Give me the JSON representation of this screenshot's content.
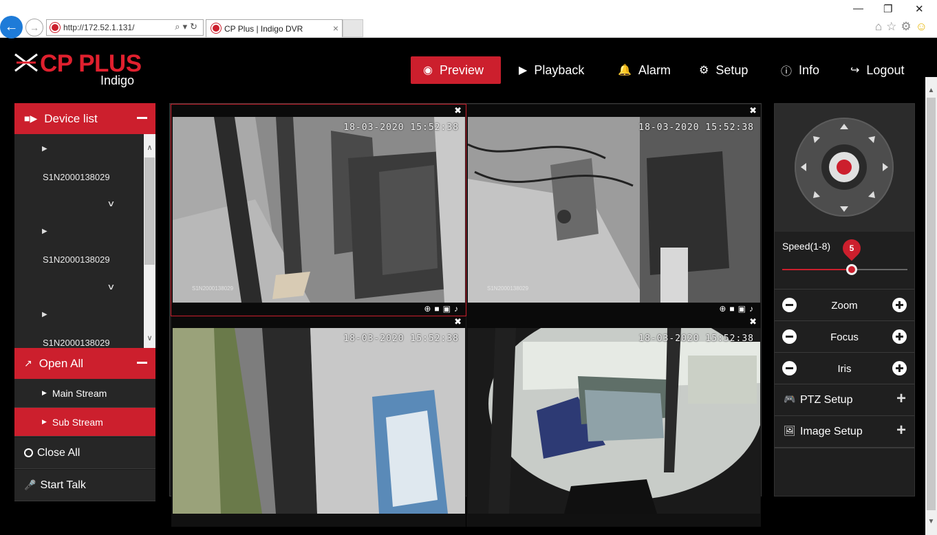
{
  "browser": {
    "url": "http://172.52.1.131/",
    "tab_title": "CP Plus | Indigo DVR",
    "tab_close": "×",
    "minimize": "—",
    "restore": "❐",
    "close": "✕"
  },
  "app": {
    "brand": "CP PLUS",
    "brand_sub": "Indigo",
    "nav": [
      {
        "label": "Preview",
        "icon": "eye-icon"
      },
      {
        "label": "Playback",
        "icon": "play-icon"
      },
      {
        "label": "Alarm",
        "icon": "bell-icon"
      },
      {
        "label": "Setup",
        "icon": "gear-icon"
      },
      {
        "label": "Info",
        "icon": "info-icon"
      },
      {
        "label": "Logout",
        "icon": "logout-icon"
      }
    ],
    "accent": "#cc1f2d"
  },
  "left_panel": {
    "device_list_title": "Device list",
    "devices": [
      {
        "name": "S1N2000138029"
      },
      {
        "name": "S1N2000138029"
      },
      {
        "name": "S1N2000138029"
      }
    ],
    "open_all_title": "Open All",
    "main_stream": "Main Stream",
    "sub_stream": "Sub Stream",
    "close_all": "Close All",
    "start_talk": "Start Talk"
  },
  "cameras": [
    {
      "timestamp": "18-03-2020 15:52:38",
      "watermark": "S1N2000138029",
      "selected": true
    },
    {
      "timestamp": "18-03-2020 15:52:38",
      "watermark": "S1N2000138029",
      "selected": false
    },
    {
      "timestamp": "18-03-2020 15:52:38",
      "watermark": "",
      "selected": false
    },
    {
      "timestamp": "18-03-2020 15:52:38",
      "watermark": "",
      "selected": false
    }
  ],
  "right_panel": {
    "speed_label": "Speed(1-8)",
    "speed_value": "5",
    "speed_min": 1,
    "speed_max": 8,
    "zoom": "Zoom",
    "focus": "Focus",
    "iris": "Iris",
    "ptz_setup": "PTZ Setup",
    "image_setup": "Image Setup"
  }
}
